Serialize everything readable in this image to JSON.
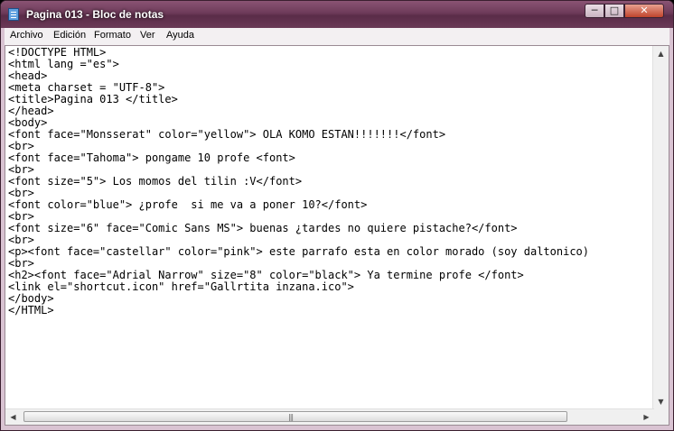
{
  "window": {
    "title": "Pagina 013 - Bloc de notas",
    "minimize": "─",
    "maximize": "□",
    "close": "✕"
  },
  "menu": [
    "Archivo",
    "Edición",
    "Formato",
    "Ver",
    "Ayuda"
  ],
  "document_lines": [
    "<!DOCTYPE HTML>",
    "<html lang =\"es\">",
    "<head>",
    "<meta charset = \"UTF-8\">",
    "<title>Pagina 013 </title>",
    "</head>",
    "<body>",
    "<font face=\"Monsserat\" color=\"yellow\"> OLA KOMO ESTAN!!!!!!!</font>",
    "<br>",
    "<font face=\"Tahoma\"> pongame 10 profe <font>",
    "<br>",
    "<font size=\"5\"> Los momos del tilin :V</font>",
    "<br>",
    "<font color=\"blue\"> ¿profe  si me va a poner 10?</font>",
    "<br>",
    "<font size=\"6\" face=\"Comic Sans MS\"> buenas ¿tardes no quiere pistache?</font>",
    "<br>",
    "<p><font face=\"castellar\" color=\"pink\"> este parrafo esta en color morado (soy daltonico)",
    "<br>",
    "<h2><font face=\"Adrial Narrow\" size=\"8\" color=\"black\"> Ya termine profe </font>",
    "<link el=\"shortcut.icon\" href=\"Gallrtita inzana.ico\">",
    "</body>",
    "</HTML>"
  ],
  "scroll": {
    "up": "▲",
    "down": "▼",
    "left": "◀",
    "right": "▶",
    "grip": "|||"
  }
}
